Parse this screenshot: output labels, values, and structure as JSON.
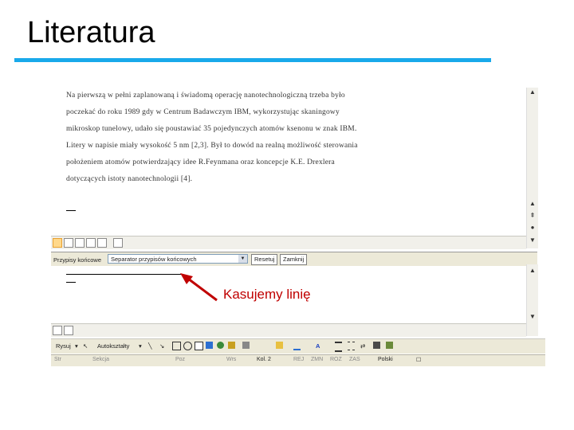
{
  "slide": {
    "title": "Literatura",
    "accent_color": "#19a9ea",
    "callout": "Kasujemy linię",
    "callout_color": "#c00000"
  },
  "document": {
    "paragraph": [
      "Na pierwszą w pełni zaplanowaną i świadomą operację nanotechnologiczną trzeba było",
      "poczekać do roku 1989 gdy w Centrum Badawczym IBM, wykorzystując skaningowy",
      "mikroskop tunelowy, udało się poustawiać 35 pojedynczych atomów ksenonu w znak IBM.",
      "Litery w napisie miały wysokość 5 nm [2,3]. Był to dowód na realną możliwość sterowania",
      "położeniem atomów potwierdzający idee R.Feynmana oraz koncepcje K.E. Drexlera",
      "dotyczących istoty nanotechnologii [4]."
    ]
  },
  "footnote_bar": {
    "label": "Przypisy końcowe",
    "dropdown_value": "Separator przypisów końcowych",
    "reset_button": "Resetuj",
    "close_button": "Zamknij"
  },
  "drawing_toolbar": {
    "draw_menu": "Rysuj",
    "autoshapes_menu": "Autokształty"
  },
  "status_bar": {
    "items": [
      "Str",
      "Sekcja",
      "Poz",
      "Wrs",
      "Kol. 2",
      "REJ",
      "ZMN",
      "ROZ",
      "ZAS",
      "Polski"
    ]
  }
}
